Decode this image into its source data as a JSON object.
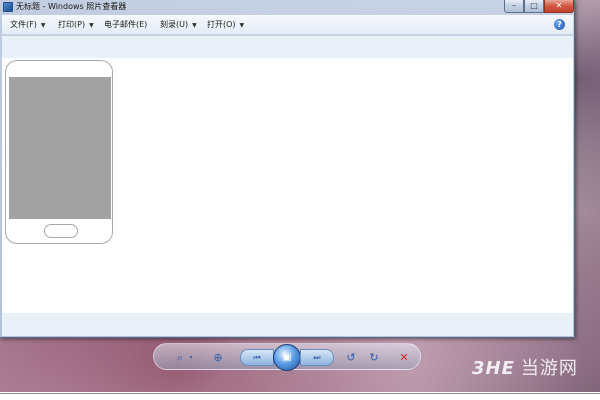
{
  "window": {
    "title": "无标题 - Windows 照片查看器",
    "controls": {
      "minimize": "–",
      "maximize": "□",
      "close": "✕"
    }
  },
  "menu": {
    "items": [
      {
        "label": "文件(F)",
        "has_dropdown": true
      },
      {
        "label": "打印(P)",
        "has_dropdown": true
      },
      {
        "label": "电子邮件(E)",
        "has_dropdown": false
      },
      {
        "label": "刻录(U)",
        "has_dropdown": true
      },
      {
        "label": "打开(O)",
        "has_dropdown": true
      }
    ],
    "help": "?"
  },
  "navbar": {
    "zoom_icon": "⌕",
    "zoom_dropdown": "▾",
    "fit_icon": "⊕",
    "prev_icon": "⏮",
    "slideshow_icon": "▣",
    "next_icon": "⏭",
    "rotate_ccw_icon": "↺",
    "rotate_cw_icon": "↻",
    "delete_icon": "✕"
  },
  "watermark": {
    "logo": "3HE",
    "text": "当游网"
  },
  "colors": {
    "accent": "#2e5fa8",
    "delete": "#d22c2c",
    "phone_screen": "#a2a2a2"
  }
}
